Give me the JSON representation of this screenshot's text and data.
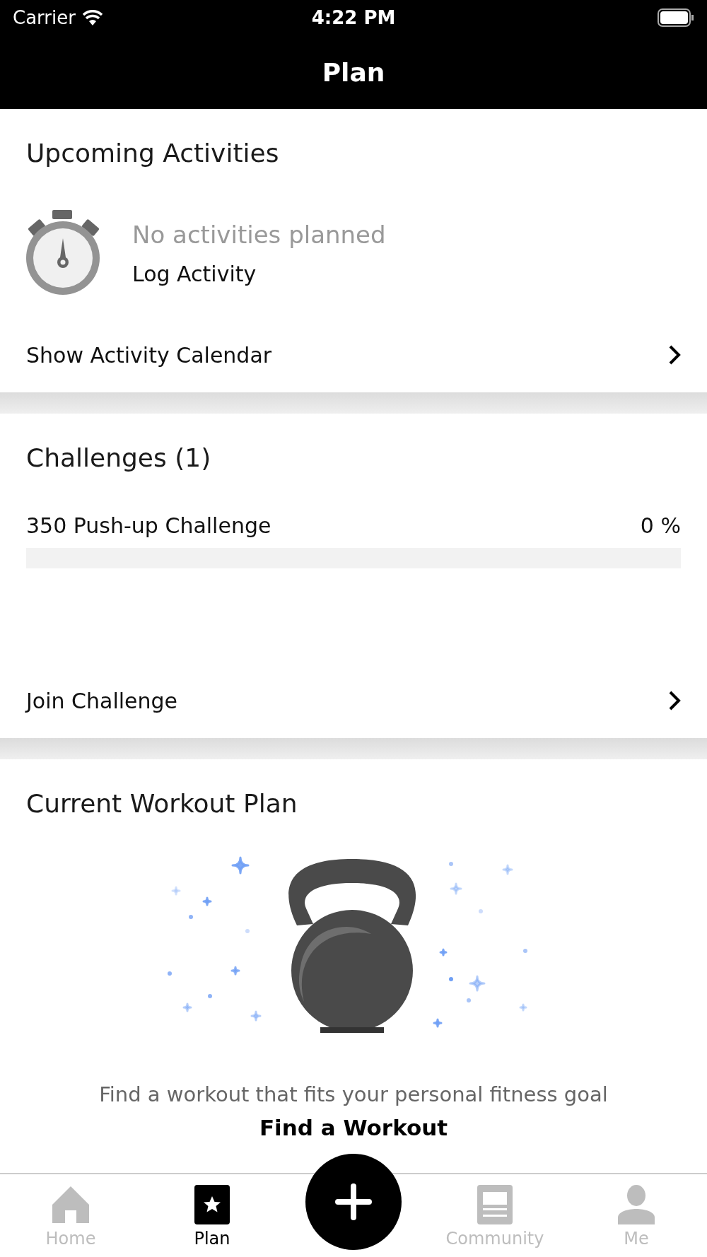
{
  "status_bar": {
    "carrier": "Carrier",
    "time": "4:22 PM"
  },
  "nav": {
    "title": "Plan"
  },
  "upcoming": {
    "title": "Upcoming Activities",
    "empty_text": "No activities planned",
    "action": "Log Activity",
    "link": "Show Activity Calendar"
  },
  "challenges": {
    "title": "Challenges (1)",
    "items": [
      {
        "name": "350 Push-up Challenge",
        "percent": "0 %"
      }
    ],
    "link": "Join Challenge"
  },
  "workout_plan": {
    "title": "Current Workout Plan",
    "description": "Find a workout that fits your personal fitness goal",
    "action": "Find a Workout"
  },
  "tab_bar": {
    "tabs": [
      {
        "label": "Home",
        "kind": "home",
        "selected": false
      },
      {
        "label": "Plan",
        "kind": "plan",
        "selected": true
      },
      {
        "kind": "add"
      },
      {
        "label": "Community",
        "kind": "community",
        "selected": false
      },
      {
        "label": "Me",
        "kind": "me",
        "selected": false
      }
    ]
  }
}
